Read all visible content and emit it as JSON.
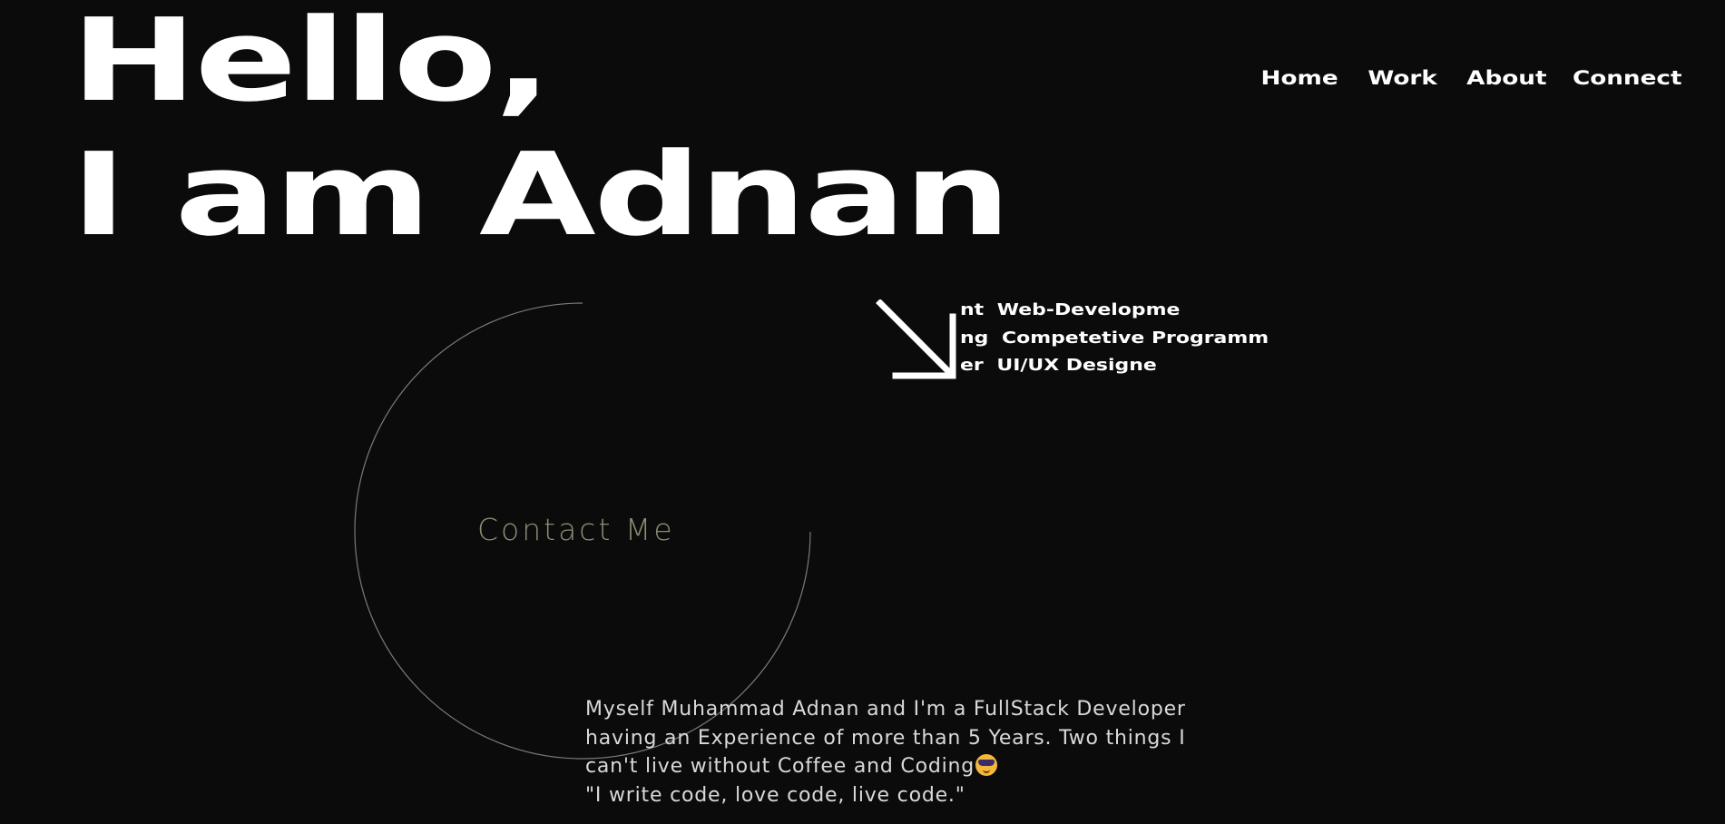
{
  "hero": {
    "line1": "Hello,",
    "line2": "I am Adnan"
  },
  "nav": {
    "items": [
      {
        "label": "Home"
      },
      {
        "label": "Work"
      },
      {
        "label": "About"
      },
      {
        "label": "Connect"
      }
    ]
  },
  "skills": {
    "arrow_icon": "arrow-down-right-icon",
    "rows": [
      {
        "prefix": "nt",
        "label": "Web-Developme"
      },
      {
        "prefix": "ng",
        "label": "Competetive Programm"
      },
      {
        "prefix": "er",
        "label": "UI/UX Designe"
      }
    ]
  },
  "contact": {
    "label": "Contact Me"
  },
  "bio": {
    "line1": "Myself Muhammad Adnan and I'm a FullStack Developer",
    "line2": "having an Experience of more than 5 Years. Two things I",
    "line3": "can't live without Coffee and Coding",
    "emoji_icon": "smiling-face-with-sunglasses-icon",
    "quote": "\"I write code, love code, live code.\""
  },
  "colors": {
    "background": "#0b0b0b",
    "text": "#ffffff",
    "contact_text": "#8d8c75",
    "circle_stroke": "#7a7a7a",
    "bio_text": "#d9d9d9"
  }
}
